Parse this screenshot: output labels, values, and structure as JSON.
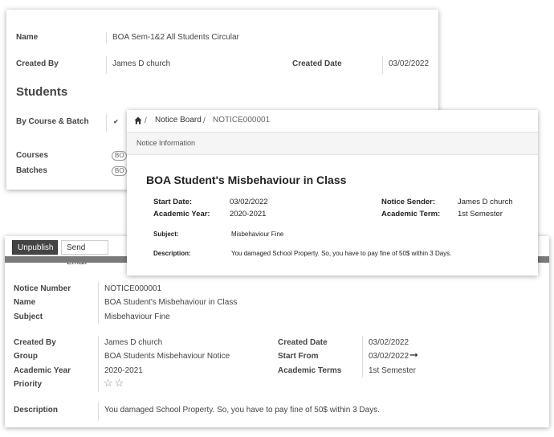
{
  "circular": {
    "name_label": "Name",
    "name": "BOA Sem-1&2 All Students Circular",
    "created_by_label": "Created By",
    "created_by": "James D church",
    "created_date_label": "Created Date",
    "created_date": "03/02/2022",
    "section_title": "Students",
    "by_course_label": "By Course & Batch",
    "by_course_checked": true,
    "courses_label": "Courses",
    "courses_tag": "BO",
    "batches_label": "Batches",
    "batches_tag": "BO"
  },
  "portal": {
    "breadcrumb": {
      "sep1": "/",
      "notice_board": "Notice Board",
      "sep2": "/",
      "current": "NOTICE000001"
    },
    "section_header": "Notice Information",
    "title": "BOA Student's Misbehaviour in Class",
    "start_date_label": "Start Date:",
    "start_date": "03/02/2022",
    "academic_year_label": "Academic Year:",
    "academic_year": "2020-2021",
    "sender_label": "Notice Sender:",
    "sender": "James D church",
    "term_label": "Academic Term:",
    "term": "1st Semester",
    "subject_label": "Subject:",
    "subject": "Misbehaviour Fine",
    "description_label": "Description:",
    "description": "You damaged School Property. So, you have to pay fine of 50$ within 3 Days."
  },
  "notice_form": {
    "unpublish_label": "Unpublish",
    "send_email_label": "Send Email",
    "notice_number_label": "Notice Number",
    "notice_number": "NOTICE000001",
    "name_label": "Name",
    "name": "BOA Student's Misbehaviour in Class",
    "subject_label": "Subject",
    "subject": "Misbehaviour Fine",
    "created_by_label": "Created By",
    "created_by": "James D church",
    "group_label": "Group",
    "group": "BOA Students Misbehaviour Notice",
    "academic_year_label": "Academic Year",
    "academic_year": "2020-2021",
    "priority_label": "Priority",
    "priority_stars": 0,
    "created_date_label": "Created Date",
    "created_date": "03/02/2022",
    "start_from_label": "Start From",
    "start_from": "03/02/2022",
    "academic_terms_label": "Academic Terms",
    "academic_terms": "1st Semester",
    "description_label": "Description",
    "description": "You damaged School Property. So, you have to pay fine of 50$ within 3 Days."
  }
}
